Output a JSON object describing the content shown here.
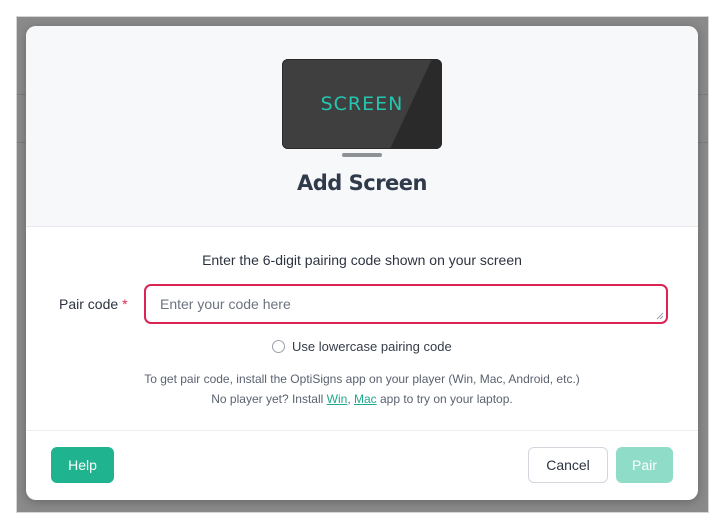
{
  "modal": {
    "illustration_text": "SCREEN",
    "title": "Add Screen",
    "instruction": "Enter the 6-digit pairing code shown on your screen",
    "pair_code": {
      "label": "Pair code",
      "required_mark": "*",
      "value": "",
      "placeholder": "Enter your code here"
    },
    "lowercase_option": {
      "label": "Use lowercase pairing code",
      "checked": false
    },
    "help": {
      "line1": "To get pair code, install the OptiSigns app on your player (Win, Mac, Android, etc.)",
      "line2_prefix": "No player yet? Install ",
      "link_win": "Win",
      "separator": ", ",
      "link_mac": "Mac",
      "line2_suffix": " app to try on your laptop."
    },
    "buttons": {
      "help": "Help",
      "cancel": "Cancel",
      "pair": "Pair"
    }
  },
  "colors": {
    "accent": "#1fb38f",
    "accent_disabled": "#8fdcc8",
    "error_border": "#dc2454",
    "screen_text": "#24c6b0",
    "link": "#1fa98a"
  }
}
